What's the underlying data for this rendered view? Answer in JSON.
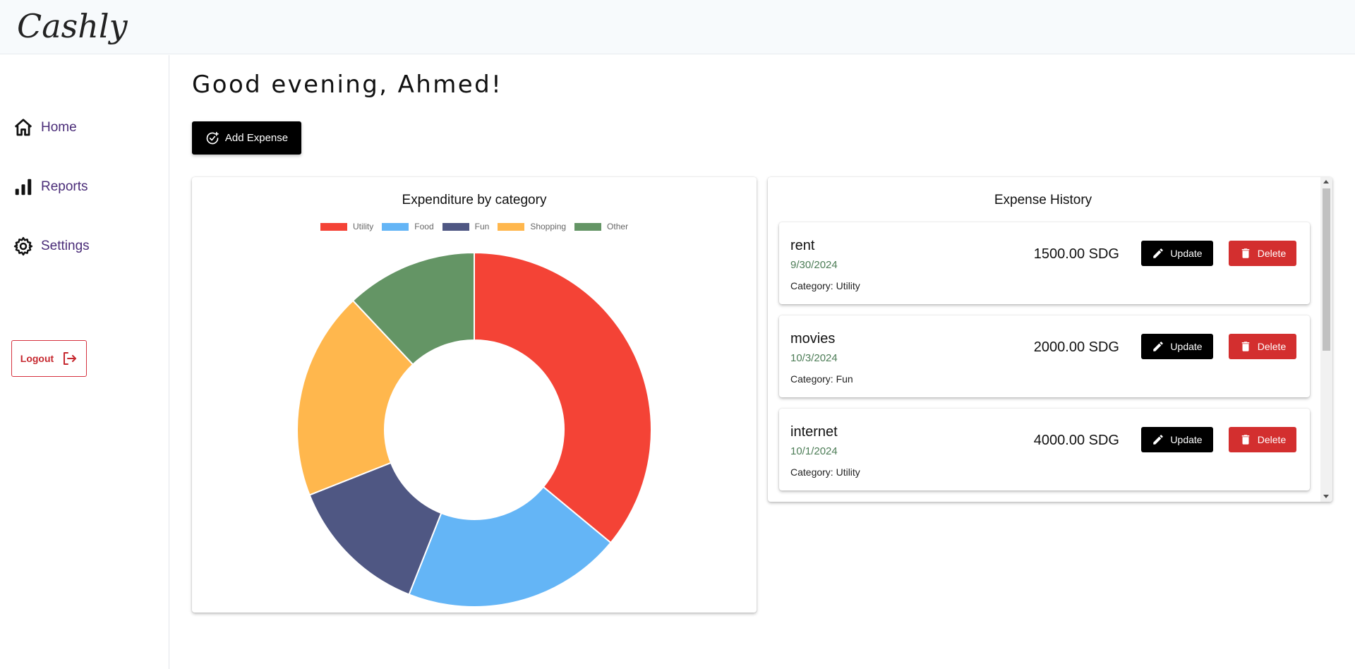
{
  "app": {
    "title": "Cashly"
  },
  "sidebar": {
    "items": [
      {
        "label": "Home",
        "icon": "home-icon"
      },
      {
        "label": "Reports",
        "icon": "bar-chart-icon"
      },
      {
        "label": "Settings",
        "icon": "gear-icon"
      }
    ],
    "logout_label": "Logout",
    "logout_icon": "logout-icon"
  },
  "main": {
    "greeting": "Good evening, Ahmed!",
    "add_expense_label": "Add Expense"
  },
  "chart_data": {
    "type": "pie",
    "title": "Expenditure by category",
    "categories": [
      "Utility",
      "Food",
      "Fun",
      "Shopping",
      "Other"
    ],
    "values": [
      36,
      20,
      13,
      19,
      12
    ],
    "colors": [
      "#f44336",
      "#64b5f6",
      "#4f5783",
      "#ffb74d",
      "#649565"
    ],
    "legend_placement": "top",
    "donut": true
  },
  "history": {
    "title": "Expense History",
    "update_label": "Update",
    "delete_label": "Delete",
    "expenses": [
      {
        "name": "rent",
        "date": "9/30/2024",
        "amount": "1500.00 SDG",
        "category": "Category: Utility"
      },
      {
        "name": "movies",
        "date": "10/3/2024",
        "amount": "2000.00 SDG",
        "category": "Category: Fun"
      },
      {
        "name": "internet",
        "date": "10/1/2024",
        "amount": "4000.00 SDG",
        "category": "Category: Utility"
      }
    ]
  },
  "colors": {
    "accent": "#4a2c78",
    "danger": "#d32f2f",
    "date_green": "#4d7d57"
  }
}
